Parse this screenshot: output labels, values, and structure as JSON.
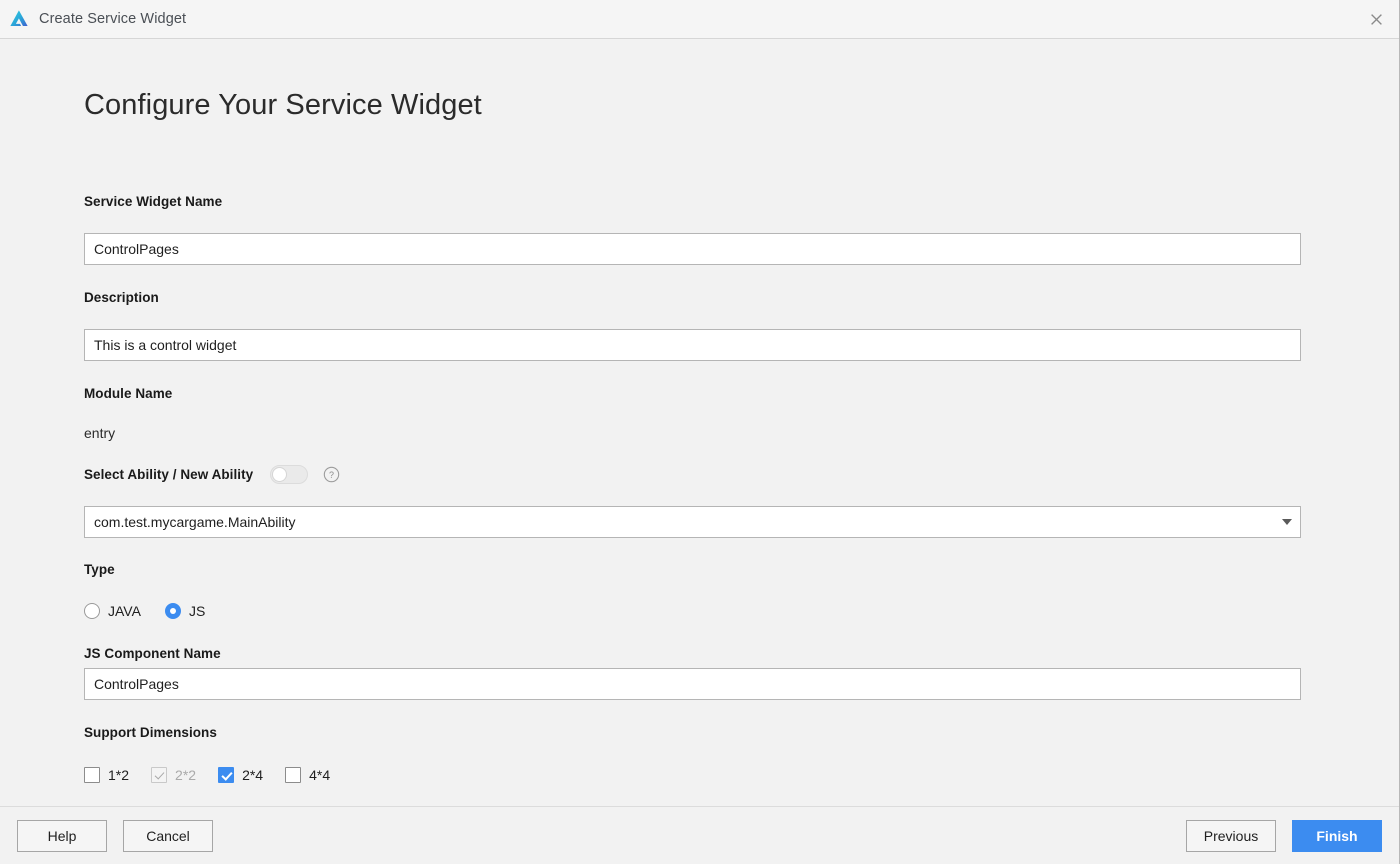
{
  "titlebar": {
    "app_icon": "huawei-devstudio-logo-icon",
    "title": "Create Service Widget",
    "close_label": "close-icon"
  },
  "page": {
    "heading": "Configure Your Service Widget"
  },
  "fields": {
    "widget_name": {
      "label": "Service Widget Name",
      "value": "ControlPages"
    },
    "description": {
      "label": "Description",
      "value": "This is a control widget"
    },
    "module_name": {
      "label": "Module Name",
      "value": "entry"
    },
    "select_ability": {
      "label": "Select Ability / New Ability",
      "toggle_state": "off",
      "help_icon": "question-mark-icon",
      "selected_option": "com.test.mycargame.MainAbility",
      "options": [
        "com.test.mycargame.MainAbility"
      ]
    },
    "type": {
      "label": "Type",
      "options": [
        {
          "label": "JAVA",
          "checked": false
        },
        {
          "label": "JS",
          "checked": true
        }
      ]
    },
    "js_component_name": {
      "label": "JS Component Name",
      "value": "ControlPages"
    },
    "support_dimensions": {
      "label": "Support Dimensions",
      "options": [
        {
          "label": "1*2",
          "checked": false,
          "disabled": false
        },
        {
          "label": "2*2",
          "checked": true,
          "disabled": true
        },
        {
          "label": "2*4",
          "checked": true,
          "disabled": false
        },
        {
          "label": "4*4",
          "checked": false,
          "disabled": false
        }
      ]
    }
  },
  "footer": {
    "help": "Help",
    "cancel": "Cancel",
    "previous": "Previous",
    "finish": "Finish"
  },
  "colors": {
    "accent": "#3c8cf0",
    "window_bg": "#f2f2f2",
    "titlebar_bg": "#f5f5f5",
    "input_bg": "#ffffff",
    "border": "#b5b5b5"
  }
}
